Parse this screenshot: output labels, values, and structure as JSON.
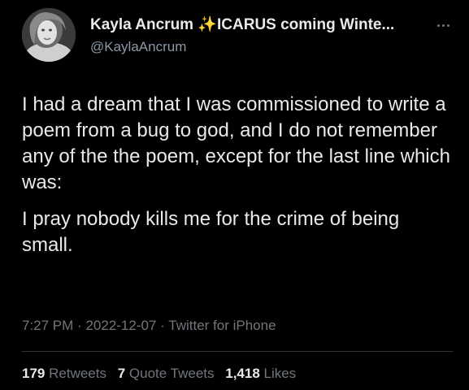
{
  "author": {
    "display_name": "Kayla Ancrum ✨ICARUS coming Winte...",
    "handle": "@KaylaAncrum"
  },
  "tweet": {
    "paragraphs": [
      "I had a dream that I was commissioned to write a poem from a bug to god, and I do not remember any of the the poem, except for the last line which was:",
      "I pray nobody kills me for the crime of being small."
    ],
    "time": "7:27 PM",
    "separator": "·",
    "date": "2022-12-07",
    "source": "Twitter for iPhone"
  },
  "stats": {
    "retweets_count": "179",
    "retweets_label": "Retweets",
    "quotes_count": "7",
    "quotes_label": "Quote Tweets",
    "likes_count": "1,418",
    "likes_label": "Likes"
  },
  "icons": {
    "more": "more-horizontal-icon",
    "avatar": "profile-avatar"
  },
  "colors": {
    "background": "#000000",
    "primary_text": "#e7e9ea",
    "secondary_text": "#71767b",
    "divider": "#2f3336"
  }
}
